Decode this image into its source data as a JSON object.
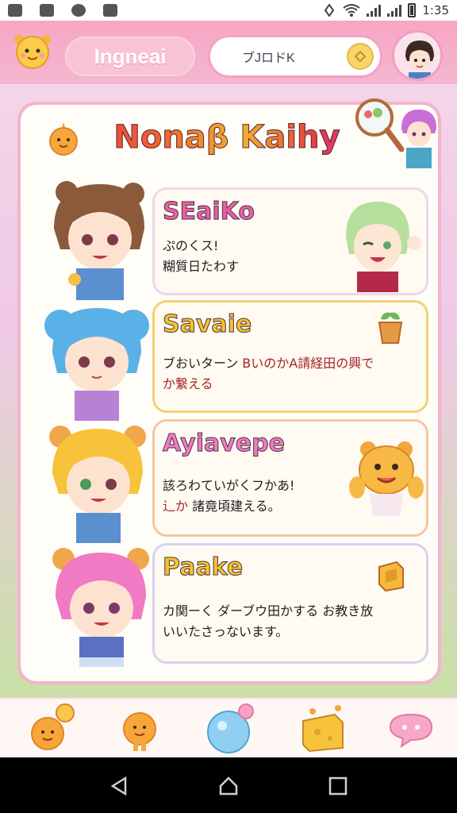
{
  "status_bar": {
    "time": "1:35"
  },
  "header": {
    "title": "Ingneai",
    "search_value": "ブJロドK"
  },
  "card": {
    "title": "Nonaβ Kaihy",
    "entries": [
      {
        "name": "SEaiKo",
        "line1": "ぷのくス!",
        "line2": "糊質日たわす"
      },
      {
        "name": "Savaie",
        "line1": "ブおいターン ",
        "line1b": "BいのかA請経田の興で",
        "line2": "か繋える"
      },
      {
        "name": "Ayiavepe",
        "line1": "該ろわていがくフかあ!",
        "line2a": "辶か ",
        "line2b": "諸竟頃建える。"
      },
      {
        "name": "Paake",
        "line1": "カ関ーく ダーブウ田かする お教き放",
        "line2": "いいたさっないます。"
      }
    ]
  },
  "colors": {
    "header_pink": "#f7a6c4",
    "card_border": "#f3b3cc",
    "accent_yellow": "#f2c22d"
  }
}
